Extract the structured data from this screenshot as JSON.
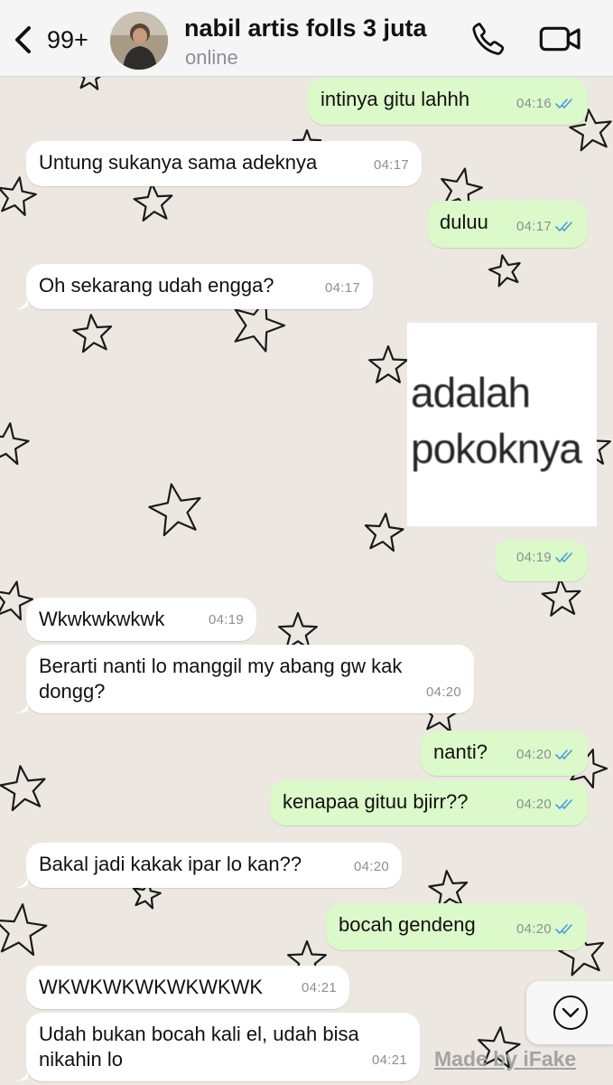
{
  "colors": {
    "incoming_bubble": "#ffffff",
    "outgoing_bubble": "#dbf9c9",
    "read_ticks": "#4a9be8",
    "wallpaper": "#ece8e1"
  },
  "header": {
    "back_count": "99+",
    "contact_name": "nabil artis folls 3 juta",
    "status": "online",
    "icons": [
      "back-chevron-icon",
      "phone-icon",
      "video-camera-icon"
    ]
  },
  "messages": [
    {
      "dir": "out",
      "text": "intinya gitu lahhh",
      "time": "04:16",
      "read": true
    },
    {
      "dir": "in",
      "text": "Untung sukanya sama adeknya",
      "time": "04:17"
    },
    {
      "dir": "out",
      "text": "duluu",
      "time": "04:17",
      "read": true
    },
    {
      "dir": "in",
      "text": "Oh sekarang udah engga?",
      "time": "04:17"
    },
    {
      "dir": "out",
      "type": "sticker",
      "sticker_lines": [
        "adalah",
        "pokoknya"
      ],
      "time": "04:19",
      "read": true
    },
    {
      "dir": "in",
      "text": "Wkwkwkwkwk",
      "time": "04:19"
    },
    {
      "dir": "in",
      "text": "Berarti nanti lo manggil my abang gw kak dongg?",
      "time": "04:20"
    },
    {
      "dir": "out",
      "text": "nanti?",
      "time": "04:20",
      "read": true
    },
    {
      "dir": "out",
      "text": "kenapaa gituu bjirr??",
      "time": "04:20",
      "read": true
    },
    {
      "dir": "in",
      "text": "Bakal jadi kakak ipar lo kan??",
      "time": "04:20"
    },
    {
      "dir": "out",
      "text": "bocah gendeng",
      "time": "04:20",
      "read": true
    },
    {
      "dir": "in",
      "text": "WKWKWKWKWKWKWK",
      "time": "04:21"
    },
    {
      "dir": "in",
      "text": "Udah bukan bocah kali el, udah bisa nikahin lo",
      "time": "04:21"
    }
  ],
  "scroll_button": {
    "icon": "chevron-down-circle-icon"
  },
  "watermark": "Made by iFake"
}
